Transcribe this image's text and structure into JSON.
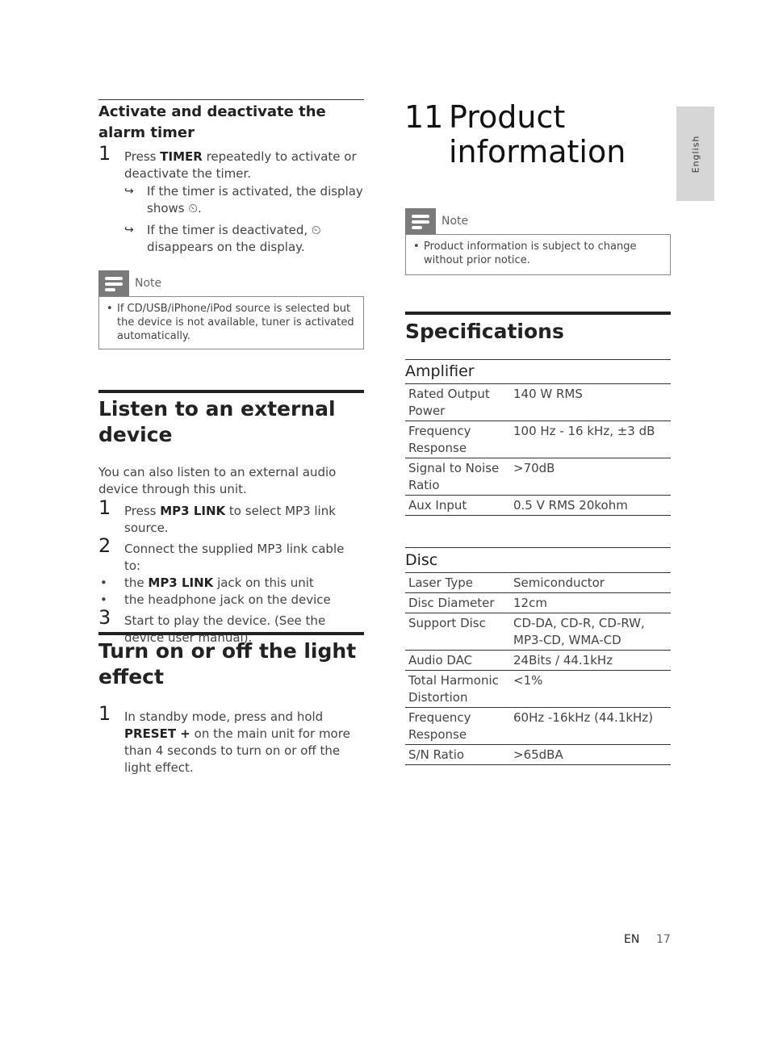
{
  "left": {
    "alarm": {
      "title": "Activate and deactivate the alarm timer",
      "steps": [
        {
          "num": "1",
          "pre": "Press ",
          "bold": "TIMER",
          "post": " repeatedly to activate or deactivate the timer.",
          "results": [
            "If the timer is activated, the display shows ⏲.",
            "If the timer is deactivated, ⏲ disappears on the display."
          ]
        }
      ],
      "note": {
        "label": "Note",
        "items": [
          "If CD/USB/iPhone/iPod source is selected but the device is not available, tuner is activated automatically."
        ]
      }
    },
    "external": {
      "title": "Listen to an external device",
      "intro": "You can also listen to an external audio device through this unit.",
      "steps": [
        {
          "num": "1",
          "pre": "Press ",
          "bold": "MP3 LINK",
          "post": " to select MP3 link source."
        },
        {
          "num": "2",
          "text": "Connect the supplied MP3 link cable to:",
          "bullets": [
            {
              "pre": "the ",
              "bold": "MP3 LINK",
              "post": " jack on this unit"
            },
            {
              "pre": "the headphone jack on the device",
              "bold": "",
              "post": ""
            }
          ]
        },
        {
          "num": "3",
          "text": "Start to play the device. (See the device user manual)."
        }
      ]
    },
    "light": {
      "title": "Turn on or off the light effect",
      "steps": [
        {
          "num": "1",
          "pre": "In standby mode, press and hold ",
          "bold": "PRESET +",
          "post": " on the main unit for more than 4 seconds to turn on or off the light effect."
        }
      ]
    }
  },
  "right": {
    "chapter_num": "11",
    "chapter_title_line1": "Product",
    "chapter_title_line2": "information",
    "note": {
      "label": "Note",
      "items": [
        "Product information is subject to change without prior notice."
      ]
    },
    "specs_title": "Specifications",
    "amplifier": {
      "title": "Amplifier",
      "rows": [
        {
          "key": "Rated Output Power",
          "value": "140 W RMS"
        },
        {
          "key": "Frequency Response",
          "value": "100 Hz - 16 kHz, ±3 dB"
        },
        {
          "key": "Signal to Noise Ratio",
          "value": ">70dB"
        },
        {
          "key": "Aux Input",
          "value": "0.5 V RMS 20kohm"
        }
      ]
    },
    "disc": {
      "title": "Disc",
      "rows": [
        {
          "key": "Laser Type",
          "value": "Semiconductor"
        },
        {
          "key": "Disc Diameter",
          "value": "12cm"
        },
        {
          "key": "Support Disc",
          "value": "CD-DA, CD-R, CD-RW, MP3-CD, WMA-CD"
        },
        {
          "key": "Audio DAC",
          "value": "24Bits / 44.1kHz"
        },
        {
          "key": "Total Harmonic Distortion",
          "value": "<1%"
        },
        {
          "key": "Frequency Response",
          "value": "60Hz -16kHz (44.1kHz)"
        },
        {
          "key": "S/N Ratio",
          "value": ">65dBA"
        }
      ]
    }
  },
  "side_tab": "English",
  "footer": {
    "lang": "EN",
    "page": "17"
  },
  "icons": {
    "arrow": "↪",
    "bullet": "•"
  }
}
